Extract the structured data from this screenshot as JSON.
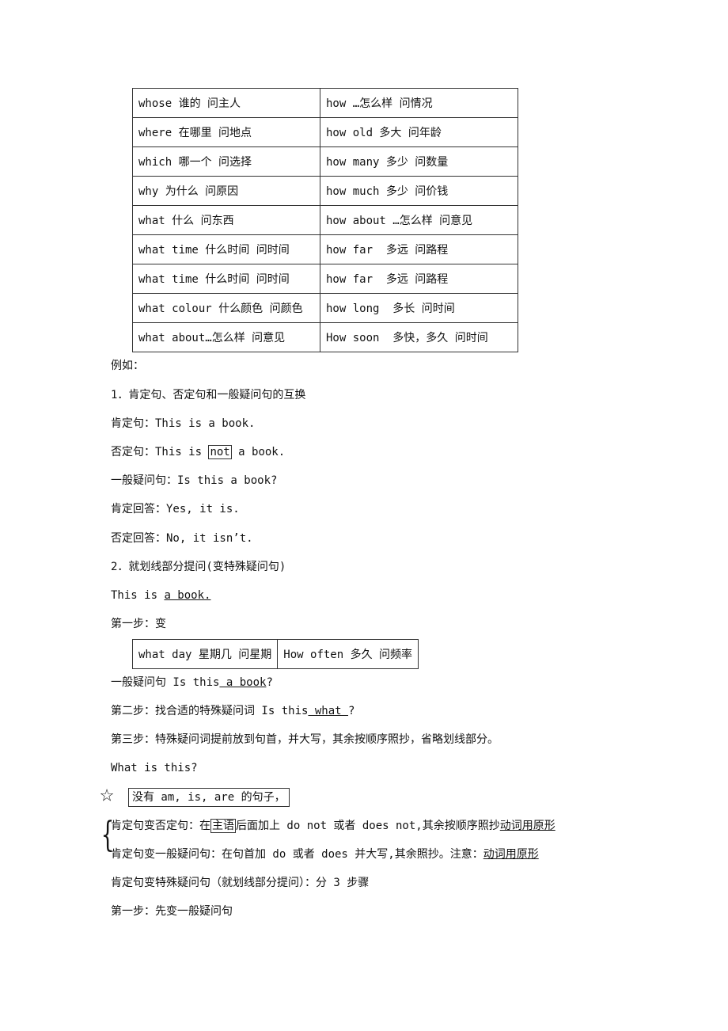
{
  "table1": [
    [
      "whose 谁的 问主人",
      "how …怎么样 问情况"
    ],
    [
      "where 在哪里 问地点",
      "how old 多大 问年龄"
    ],
    [
      "which 哪一个 问选择",
      "how many 多少 问数量"
    ],
    [
      "why 为什么 问原因",
      "how much 多少 问价钱"
    ],
    [
      "what 什么 问东西",
      "how about …怎么样 问意见"
    ],
    [
      "what time 什么时间 问时间",
      "how far  多远 问路程"
    ],
    [
      "what time 什么时间 问时间",
      "how far  多远 问路程"
    ],
    [
      "what colour 什么颜色 问颜色",
      "how long  多长 问时间"
    ],
    [
      "what about…怎么样 问意见",
      "How soon  多快，多久 问时间"
    ]
  ],
  "example_label": "例如：",
  "sec1": {
    "title": "1．肯定句、否定句和一般疑问句的互换",
    "affirmative": "肯定句：This is a book.",
    "negative_pre": "否定句：This is ",
    "negative_box": "not",
    "negative_post": " a book.",
    "question": "一般疑问句：Is this a book?",
    "yes": "肯定回答：Yes, it is.",
    "no": "否定回答：No, it isn’t."
  },
  "sec2": {
    "title": "2．就划线部分提问(变特殊疑问句)",
    "sentence_pre": "This is ",
    "sentence_u": "a book.",
    "step1": "第一步：变"
  },
  "table2": [
    "what day 星期几 问星期",
    "How often 多久 问频率"
  ],
  "step1b_pre": "一般疑问句 Is this",
  "step1b_u": " a book",
  "step1b_post": "?",
  "step2_pre": "第二步：找合适的特殊疑问词 Is this",
  "step2_u": " what ",
  "step2_post": "?",
  "step3": "第三步：特殊疑问词提前放到句首，并大写，其余按顺序照抄，省略划线部分。",
  "result": "What is this?",
  "star_note": "没有 am, is, are 的句子，",
  "rule1_pre": "肯定句变否定句：在",
  "rule1_box": "主语",
  "rule1_mid": "后面加上 do not 或者 does not,其余按顺序照抄",
  "rule1_u": "动词用原形",
  "rule2_pre": "肯定句变一般疑问句：在句首加 do 或者 does 并大写,其余照抄。注意：",
  "rule2_u": "动词用原形",
  "rule3": "肯定句变特殊疑问句（就划线部分提问）：分 3 步骤",
  "rule4": "第一步：先变一般疑问句"
}
